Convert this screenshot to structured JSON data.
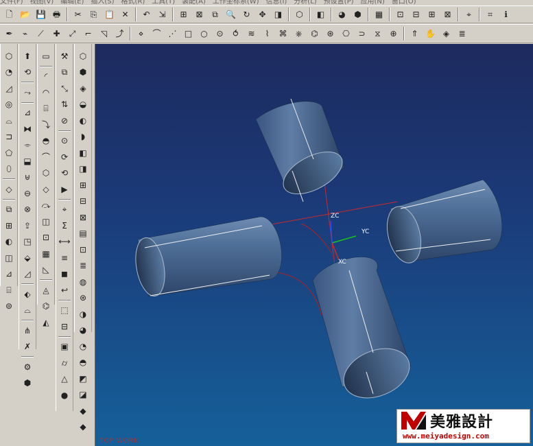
{
  "menubar": {
    "items": [
      "文件(F)",
      "视图(V)",
      "编辑(E)",
      "插入(S)",
      "格式(R)",
      "工具(T)",
      "装配(A)",
      "工作坐标系(W)",
      "信息(I)",
      "分析(L)",
      "预设置(P)",
      "应用(N)",
      "窗口(O)"
    ]
  },
  "viewport": {
    "view_name": "TOP WORK",
    "axis_labels": {
      "z": "ZC",
      "y": "YC",
      "x": "XC"
    }
  },
  "colors": {
    "cylinder": "#4a6e96",
    "background_top": "#1d2a5e",
    "background_bottom": "#15609a",
    "datum_line": "#cc2a2a",
    "y_axis": "#19c819",
    "z_axis": "#2050ff"
  },
  "watermark": {
    "logo": "M",
    "brand": "美雅設計",
    "url": "www.meiyadesign.com"
  },
  "toolbar1": [
    {
      "name": "new-file-icon",
      "g": "🗋"
    },
    {
      "name": "open-folder-icon",
      "g": "📂"
    },
    {
      "name": "save-icon",
      "g": "💾"
    },
    {
      "name": "print-icon",
      "g": "🖶"
    },
    {
      "sep": true
    },
    {
      "name": "cut-icon",
      "g": "✂"
    },
    {
      "name": "copy-icon",
      "g": "⎘"
    },
    {
      "name": "paste-icon",
      "g": "📋"
    },
    {
      "name": "delete-icon",
      "g": "✕"
    },
    {
      "sep": true
    },
    {
      "name": "undo-icon",
      "g": "↶"
    },
    {
      "name": "select-icon",
      "g": "⇲"
    },
    {
      "sep": true
    },
    {
      "name": "fit-view-icon",
      "g": "⊞"
    },
    {
      "name": "zoom-window-icon",
      "g": "⊠"
    },
    {
      "name": "zoom-area-icon",
      "g": "⧉"
    },
    {
      "name": "zoom-icon",
      "g": "🔍"
    },
    {
      "name": "rotate-icon",
      "g": "↻"
    },
    {
      "name": "pan-icon",
      "g": "✥"
    },
    {
      "name": "perspective-icon",
      "g": "◨"
    },
    {
      "sep": true
    },
    {
      "name": "view-orient-icon",
      "g": "⬡"
    },
    {
      "sep": true
    },
    {
      "name": "shaded-icon",
      "g": "◧"
    },
    {
      "sep": true
    },
    {
      "name": "render-icon",
      "g": "◕"
    },
    {
      "name": "render-style-icon",
      "g": "⬢"
    },
    {
      "sep": true
    },
    {
      "name": "layer-icon",
      "g": "▦"
    },
    {
      "sep": true
    },
    {
      "name": "part-navigator-icon",
      "g": "⊡"
    },
    {
      "name": "assembly-navigator-icon",
      "g": "⊟"
    },
    {
      "name": "history-icon",
      "g": "⊞"
    },
    {
      "name": "snapshot-icon",
      "g": "⊠"
    },
    {
      "sep": true
    },
    {
      "name": "wcs-icon",
      "g": "⌖"
    },
    {
      "sep": true
    },
    {
      "name": "analysis-icon",
      "g": "⌗"
    },
    {
      "name": "info-icon",
      "g": "ℹ"
    }
  ],
  "toolbar2": [
    {
      "name": "point-icon",
      "g": "✒"
    },
    {
      "name": "point-set-icon",
      "g": "⌁"
    },
    {
      "name": "line-icon",
      "g": "⟋"
    },
    {
      "name": "basic-curve-icon",
      "g": "✚"
    },
    {
      "name": "spline-icon",
      "g": "⤢"
    },
    {
      "name": "fillet-curve-icon",
      "g": "⌐"
    },
    {
      "name": "chamfer-curve-icon",
      "g": "◹"
    },
    {
      "name": "offset-curve-icon",
      "g": "⤴"
    },
    {
      "sep": true
    },
    {
      "name": "point-icon",
      "g": "⋄"
    },
    {
      "name": "polyline-icon",
      "g": "⌒"
    },
    {
      "name": "studio-spline-icon",
      "g": "⋰"
    },
    {
      "name": "rectangle-icon",
      "g": "□"
    },
    {
      "name": "circle-icon",
      "g": "○"
    },
    {
      "name": "ellipse-icon",
      "g": "⊙"
    },
    {
      "name": "helix-icon",
      "g": "⥀"
    },
    {
      "name": "curve-text-icon",
      "g": "≋"
    },
    {
      "name": "bridge-curve-icon",
      "g": "⌇"
    },
    {
      "name": "join-icon",
      "g": "⌘"
    },
    {
      "name": "project-icon",
      "g": "⎈"
    },
    {
      "name": "intersection-icon",
      "g": "⌬"
    },
    {
      "name": "section-icon",
      "g": "⊛"
    },
    {
      "name": "extract-icon",
      "g": "⎔"
    },
    {
      "name": "trim-icon",
      "g": "⊃"
    },
    {
      "name": "divide-icon",
      "g": "⧖"
    },
    {
      "name": "edit-curve-icon",
      "g": "⊕"
    },
    {
      "sep": true
    },
    {
      "name": "extrude-icon",
      "g": "⇑"
    },
    {
      "name": "hand-tool-icon",
      "g": "✋"
    },
    {
      "name": "surface-icon",
      "g": "◈"
    },
    {
      "name": "layer-settings-icon",
      "g": "≣"
    }
  ],
  "vbar1": [
    {
      "name": "feature-block-icon",
      "g": "⬡"
    },
    {
      "name": "fillet-icon",
      "g": "◔"
    },
    {
      "name": "chamfer-icon",
      "g": "◿"
    },
    {
      "name": "hole-icon",
      "g": "◎"
    },
    {
      "name": "boss-icon",
      "g": "⌓"
    },
    {
      "name": "pocket-icon",
      "g": "⊐"
    },
    {
      "name": "pad-icon",
      "g": "⬠"
    },
    {
      "name": "slot-icon",
      "g": "⬯"
    },
    {
      "sep": true
    },
    {
      "name": "groove-icon",
      "g": "◇"
    },
    {
      "sep": true
    },
    {
      "name": "thread-icon",
      "g": "⧉"
    },
    {
      "name": "pattern-icon",
      "g": "⊞"
    },
    {
      "name": "mirror-icon",
      "g": "◐"
    },
    {
      "name": "offset-face-icon",
      "g": "◫"
    },
    {
      "name": "scale-body-icon",
      "g": "⊿"
    },
    {
      "name": "shell-icon",
      "g": "⌸"
    },
    {
      "name": "tube-icon",
      "g": "⊚"
    }
  ],
  "vbar2": [
    {
      "name": "extrude-feature-icon",
      "g": "⬆"
    },
    {
      "name": "revolve-icon",
      "g": "⟲"
    },
    {
      "sep": true
    },
    {
      "name": "sweep-icon",
      "g": "⤳"
    },
    {
      "sep": true
    },
    {
      "name": "trim-body-icon",
      "g": "⊿"
    },
    {
      "name": "split-body-icon",
      "g": "⧓"
    },
    {
      "name": "sew-icon",
      "g": "⌯"
    },
    {
      "name": "patch-icon",
      "g": "⬓"
    },
    {
      "name": "unite-icon",
      "g": "⊎"
    },
    {
      "name": "subtract-icon",
      "g": "⊖"
    },
    {
      "name": "intersect-icon",
      "g": "⊗"
    },
    {
      "name": "promote-icon",
      "g": "⇪"
    },
    {
      "name": "wrap-icon",
      "g": "◳"
    },
    {
      "name": "emboss-icon",
      "g": "⬙"
    },
    {
      "name": "draft-icon",
      "g": "◿"
    },
    {
      "sep": true
    },
    {
      "name": "dart-icon",
      "g": "⬖"
    },
    {
      "name": "lip-icon",
      "g": "⌓"
    },
    {
      "sep": true
    },
    {
      "name": "rib-icon",
      "g": "⋔"
    },
    {
      "name": "delete-face-icon",
      "g": "✗"
    },
    {
      "sep": true
    },
    {
      "name": "user-feature-icon",
      "g": "⚙"
    },
    {
      "name": "library-icon",
      "g": "⬢"
    }
  ],
  "vbar3": [
    {
      "name": "bounded-plane-icon",
      "g": "▭"
    },
    {
      "sep": true
    },
    {
      "name": "ruled-icon",
      "g": "◜"
    },
    {
      "name": "through-curves-icon",
      "g": "◠"
    },
    {
      "name": "through-mesh-icon",
      "g": "⌸"
    },
    {
      "name": "swept-icon",
      "g": "⤵"
    },
    {
      "name": "section-surface-icon",
      "g": "◓"
    },
    {
      "name": "bridge-surface-icon",
      "g": "⌒"
    },
    {
      "name": "n-sided-icon",
      "g": "⬡"
    },
    {
      "name": "transition-icon",
      "g": "◇"
    },
    {
      "name": "extension-icon",
      "g": "⤼"
    },
    {
      "name": "offset-surface-icon",
      "g": "◫"
    },
    {
      "name": "rough-offset-icon",
      "g": "⊡"
    },
    {
      "name": "quilt-icon",
      "g": "▦"
    },
    {
      "name": "law-extension-icon",
      "g": "◺"
    },
    {
      "sep": true
    },
    {
      "name": "global-shaping-icon",
      "g": "◬"
    },
    {
      "name": "fit-surface-icon",
      "g": "⌬"
    },
    {
      "name": "styled-blend-icon",
      "g": "◭"
    }
  ],
  "vbar4": [
    {
      "name": "edit-feature-icon",
      "g": "⚒"
    },
    {
      "name": "edit-parameters-icon",
      "g": "⧉"
    },
    {
      "name": "move-feature-icon",
      "g": "⤡"
    },
    {
      "name": "reorder-icon",
      "g": "⇅"
    },
    {
      "name": "suppress-icon",
      "g": "⊘"
    },
    {
      "sep": true
    },
    {
      "name": "unsuppress-icon",
      "g": "⊙"
    },
    {
      "name": "replace-icon",
      "g": "⟳"
    },
    {
      "name": "update-icon",
      "g": "⟲"
    },
    {
      "name": "playback-icon",
      "g": "▶"
    },
    {
      "sep": true
    },
    {
      "name": "positioning-icon",
      "g": "⌖"
    },
    {
      "name": "expression-icon",
      "g": "Σ"
    },
    {
      "name": "dimension-icon",
      "g": "⟷"
    },
    {
      "name": "attributes-icon",
      "g": "≡"
    },
    {
      "name": "solid-density-icon",
      "g": "◼"
    },
    {
      "name": "rollback-icon",
      "g": "↩"
    },
    {
      "sep": true
    },
    {
      "name": "edit-body-icon",
      "g": "⬚"
    },
    {
      "name": "remove-parameters-icon",
      "g": "⊟"
    },
    {
      "sep": true
    },
    {
      "name": "block-icon",
      "g": "▣"
    },
    {
      "name": "cylinder-icon",
      "g": "⌭"
    },
    {
      "name": "cone-icon",
      "g": "△"
    },
    {
      "name": "sphere-icon",
      "g": "●"
    }
  ],
  "vbar5": [
    {
      "name": "datum-plane-icon",
      "g": "⬡"
    },
    {
      "name": "datum-axis-icon",
      "g": "⬢"
    },
    {
      "name": "datum-csys-icon",
      "g": "◈"
    },
    {
      "name": "face-blend-icon",
      "g": "◒"
    },
    {
      "name": "soft-blend-icon",
      "g": "◐"
    },
    {
      "name": "edge-blend-icon",
      "g": "◗"
    },
    {
      "name": "sketch-icon",
      "g": "◧"
    },
    {
      "name": "projection-icon",
      "g": "◨"
    },
    {
      "name": "wave-icon",
      "g": "⊞"
    },
    {
      "name": "measure-icon",
      "g": "⊟"
    },
    {
      "name": "section-view-icon",
      "g": "⊠"
    },
    {
      "name": "table-icon",
      "g": "▤"
    },
    {
      "name": "family-icon",
      "g": "⊡"
    },
    {
      "name": "expression-list-icon",
      "g": "≣"
    },
    {
      "name": "check-geometry-icon",
      "g": "◍"
    },
    {
      "name": "interference-icon",
      "g": "⊛"
    },
    {
      "name": "silhouette-icon",
      "g": "◑"
    },
    {
      "name": "curvature-icon",
      "g": "◕"
    },
    {
      "name": "face-analysis-icon",
      "g": "◔"
    },
    {
      "name": "reflection-icon",
      "g": "◓"
    },
    {
      "name": "deviation-icon",
      "g": "◩"
    },
    {
      "name": "gap-icon",
      "g": "◪"
    },
    {
      "name": "blend-face-icon",
      "g": "◆"
    },
    {
      "name": "color-icon",
      "g": "◆"
    }
  ]
}
